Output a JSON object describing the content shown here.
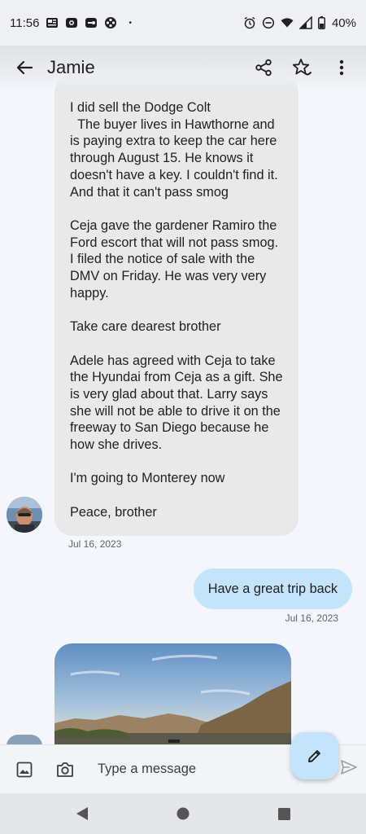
{
  "status_bar": {
    "time": "11:56",
    "battery": "40%",
    "dot": "•"
  },
  "header": {
    "title": "Jamie",
    "back_icon": "arrow-back-icon",
    "share_icon": "share-icon",
    "star_icon": "star-icon",
    "more_icon": "more-vert-icon"
  },
  "messages": [
    {
      "direction": "received",
      "text": "I did sell the Dodge Colt\n  The buyer lives in Hawthorne and is paying extra to keep the car here through August 15. He knows it doesn't have a key. I couldn't find it. And that it can't pass smog\n\nCeja gave the gardener Ramiro the Ford escort that will not pass smog. I filed the notice of sale with the DMV on Friday. He was very very happy.\n\nTake care dearest brother\n\nAdele has agreed with Ceja to take the Hyundai from Ceja as a gift. She is very glad about that. Larry says she will not be able to drive it on the freeway to San Diego because he how she drives.\n\nI'm going to Monterey now\n\nPeace, brother",
      "timestamp": "Jul 16, 2023"
    },
    {
      "direction": "sent",
      "text": "Have a great trip back",
      "timestamp": "Jul 16, 2023"
    },
    {
      "direction": "received",
      "type": "image",
      "image_icon": "landscape-photo"
    }
  ],
  "compose": {
    "placeholder": "Type a message",
    "gallery_icon": "image-icon",
    "camera_icon": "camera-icon",
    "send_icon": "send-icon",
    "fab_icon": "pencil-icon"
  },
  "nav": {
    "back_icon": "nav-back-icon",
    "home_icon": "nav-home-icon",
    "recents_icon": "nav-recents-icon"
  },
  "colors": {
    "received_bubble": "#e9e9ea",
    "sent_bubble": "#c3e4fb",
    "background": "#f4f6fb"
  }
}
